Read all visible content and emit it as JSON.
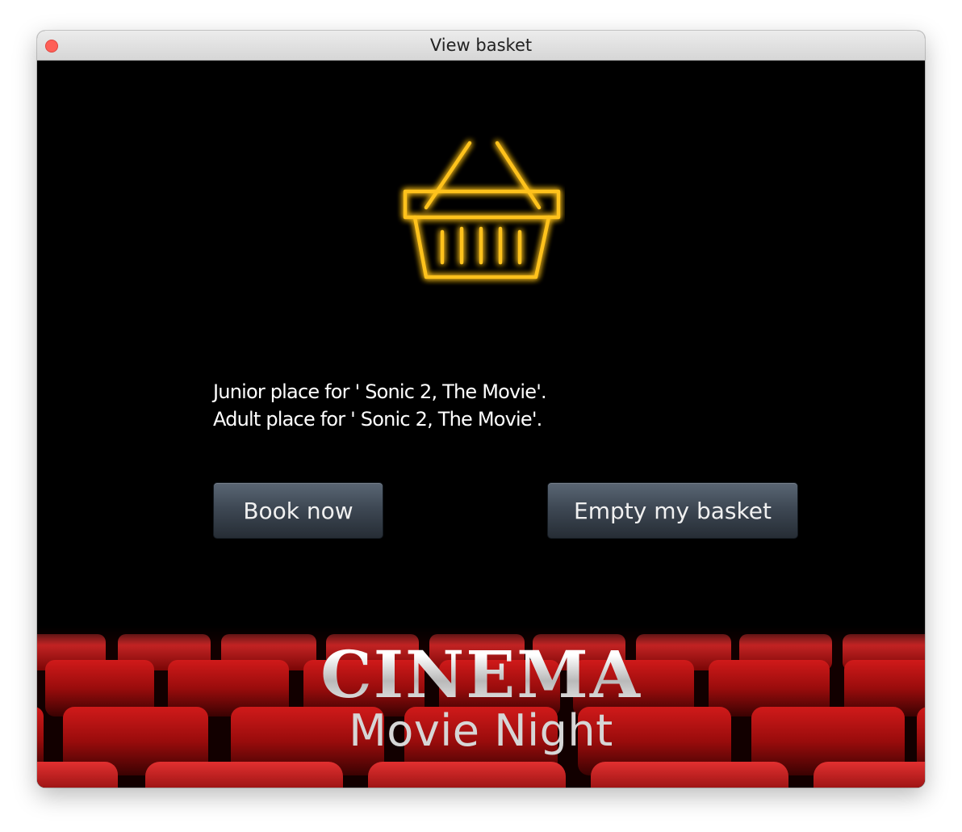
{
  "window": {
    "title": "View basket"
  },
  "basket": {
    "icon": "basket-icon",
    "icon_color": "#ffc21a",
    "items": [
      "Junior place for ' Sonic 2, The Movie'.",
      "Adult place for ' Sonic 2, The Movie'."
    ]
  },
  "actions": {
    "book_label": "Book now",
    "empty_label": "Empty my basket"
  },
  "banner": {
    "title": "CINEMA",
    "subtitle": "Movie Night",
    "seat_color": "#b31010"
  }
}
